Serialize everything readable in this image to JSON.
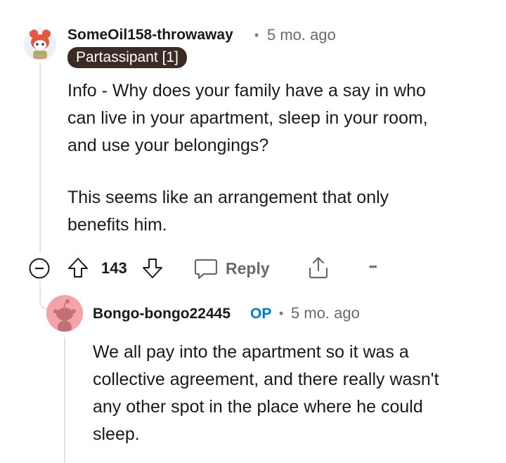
{
  "comment": {
    "username": "SomeOil158-throwaway",
    "separator": "•",
    "time": "5 mo. ago",
    "flair": "Partassipant [1]",
    "paragraphs": [
      "Info - Why does your family have a say in who\ncan live in your apartment, sleep in your room,\nand use your belongings?",
      "This seems like an arrangement that only\nbenefits him."
    ],
    "score": "143",
    "reply_label": "Reply",
    "more_label": "•••"
  },
  "reply": {
    "username": "Bongo-bongo22445",
    "op_tag": "OP",
    "separator": "•",
    "time": "5 mo. ago",
    "text": "We all pay into the apartment so it was a\ncollective agreement, and there really wasn't\nany other spot in the place where he could\nsleep."
  },
  "colors": {
    "flair_bg": "#3a2b25",
    "op_blue": "#0079d3",
    "thread_line": "#e3e3e3",
    "reply_avatar_bg": "#f4a3a8",
    "avatar_orange": "#e8553e"
  },
  "icons": {
    "collapse": "collapse-minus-icon",
    "upvote": "upvote-arrow-icon",
    "downvote": "downvote-arrow-icon",
    "reply": "speech-bubble-icon",
    "share": "share-upload-icon",
    "more": "more-dots-icon"
  }
}
